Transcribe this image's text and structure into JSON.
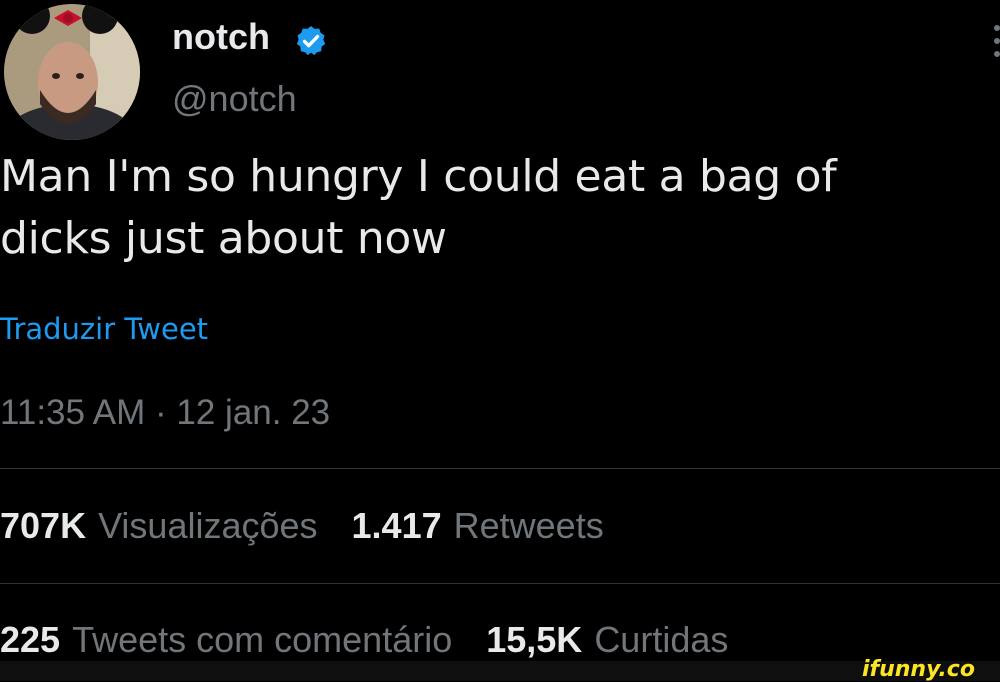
{
  "tweet": {
    "author": {
      "display_name": "notch",
      "handle": "@notch",
      "verified": true,
      "avatar": "avatar-photo"
    },
    "text": "Man I'm so hungry I could eat a bag of\ndicks just about now",
    "translate_label": "Traduzir Tweet",
    "timestamp": "11:35 AM · 12 jan. 23",
    "stats": {
      "views": {
        "count": "707K",
        "label": "Visualizações"
      },
      "retweets": {
        "count": "1.417",
        "label": "Retweets"
      },
      "quotes": {
        "count": "225",
        "label": "Tweets com comentário"
      },
      "likes": {
        "count": "15,5K",
        "label": "Curtidas"
      }
    }
  },
  "icons": {
    "verified": "verified-badge-icon",
    "more": "more-options-icon"
  },
  "colors": {
    "background": "#000000",
    "text_primary": "#e7e9ea",
    "text_secondary": "#71767b",
    "link": "#1d9bf0",
    "verified": "#1d9bf0",
    "divider": "#2f3336",
    "watermark": "#fce522"
  },
  "watermark": {
    "text": "ifunny.co"
  }
}
